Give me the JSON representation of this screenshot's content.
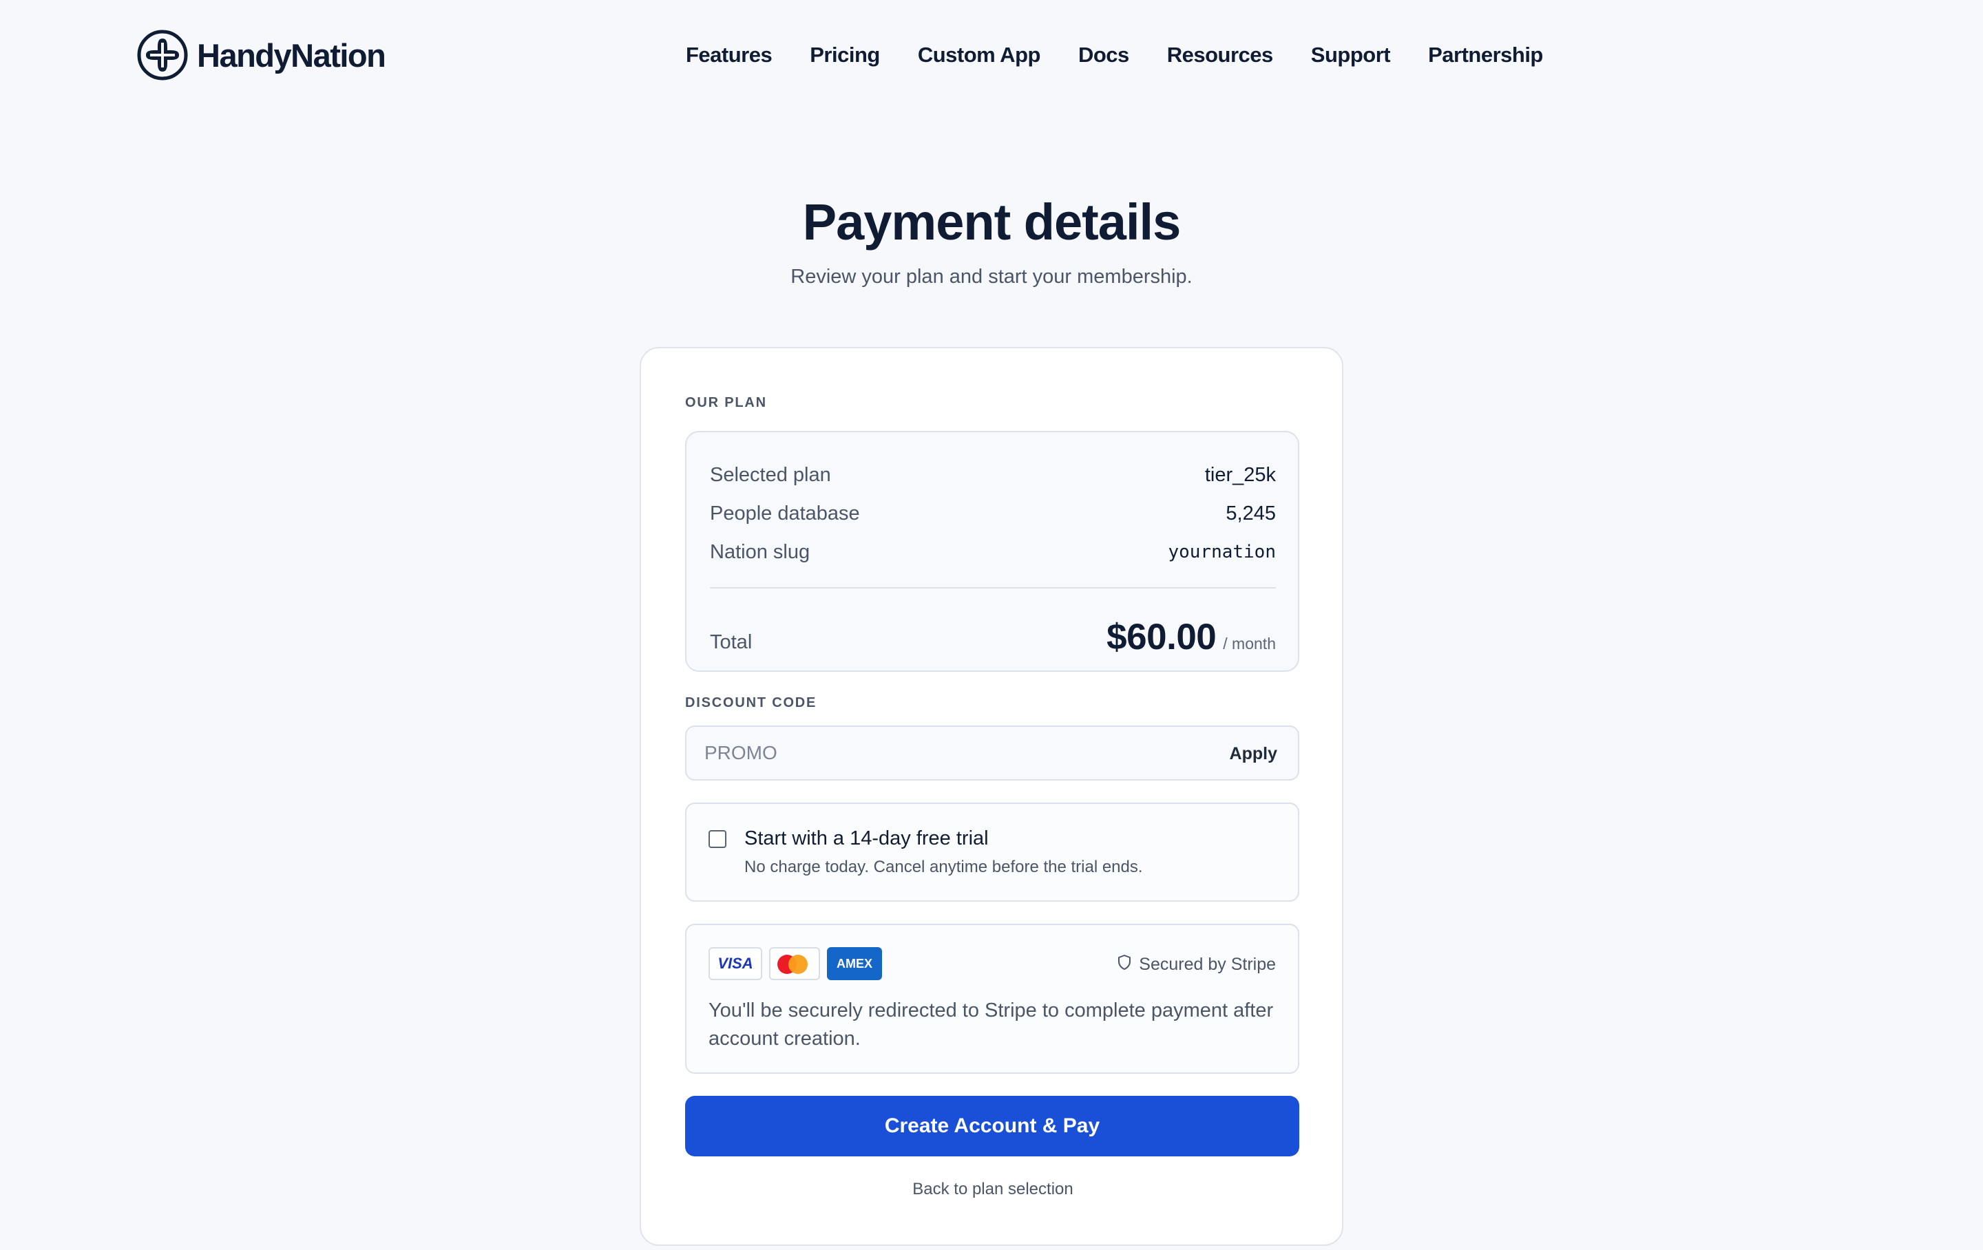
{
  "brand": {
    "name": "HandyNation",
    "logo_icon": "handynation-cross-icon"
  },
  "nav": {
    "items": [
      {
        "label": "Features"
      },
      {
        "label": "Pricing"
      },
      {
        "label": "Custom App"
      },
      {
        "label": "Docs"
      },
      {
        "label": "Resources"
      },
      {
        "label": "Support"
      },
      {
        "label": "Partnership"
      }
    ]
  },
  "page": {
    "title": "Payment details",
    "subtitle": "Review your plan and start your membership."
  },
  "plan": {
    "section_label": "OUR PLAN",
    "rows": [
      {
        "key": "Selected plan",
        "value": "tier_25k"
      },
      {
        "key": "People database",
        "value": "5,245"
      },
      {
        "key": "Nation slug",
        "value": "yournation"
      }
    ],
    "total_label": "Total",
    "total_amount": "$60.00",
    "total_period": "/ month"
  },
  "discount": {
    "section_label": "DISCOUNT CODE",
    "placeholder": "PROMO",
    "value": "",
    "apply_label": "Apply"
  },
  "trial": {
    "checked": false,
    "title": "Start with a 14-day free trial",
    "description": "No charge today. Cancel anytime before the trial ends."
  },
  "payment": {
    "card_brands": [
      "VISA",
      "mastercard",
      "AMEX"
    ],
    "secured_label": "Secured by Stripe",
    "secured_icon": "shield-icon",
    "note": "You'll be securely redirected to Stripe to complete payment after account creation."
  },
  "actions": {
    "primary_label": "Create Account & Pay",
    "back_label": "Back to plan selection"
  },
  "colors": {
    "background": "#f6f8fb",
    "text_primary": "#0f1c33",
    "text_secondary": "#4a5568",
    "primary_button": "#1a4fd8",
    "amex_blue": "#1467c8",
    "visa_blue": "#1a37b8",
    "mastercard_red": "#eb1c26",
    "mastercard_yellow": "#f99f1b"
  }
}
